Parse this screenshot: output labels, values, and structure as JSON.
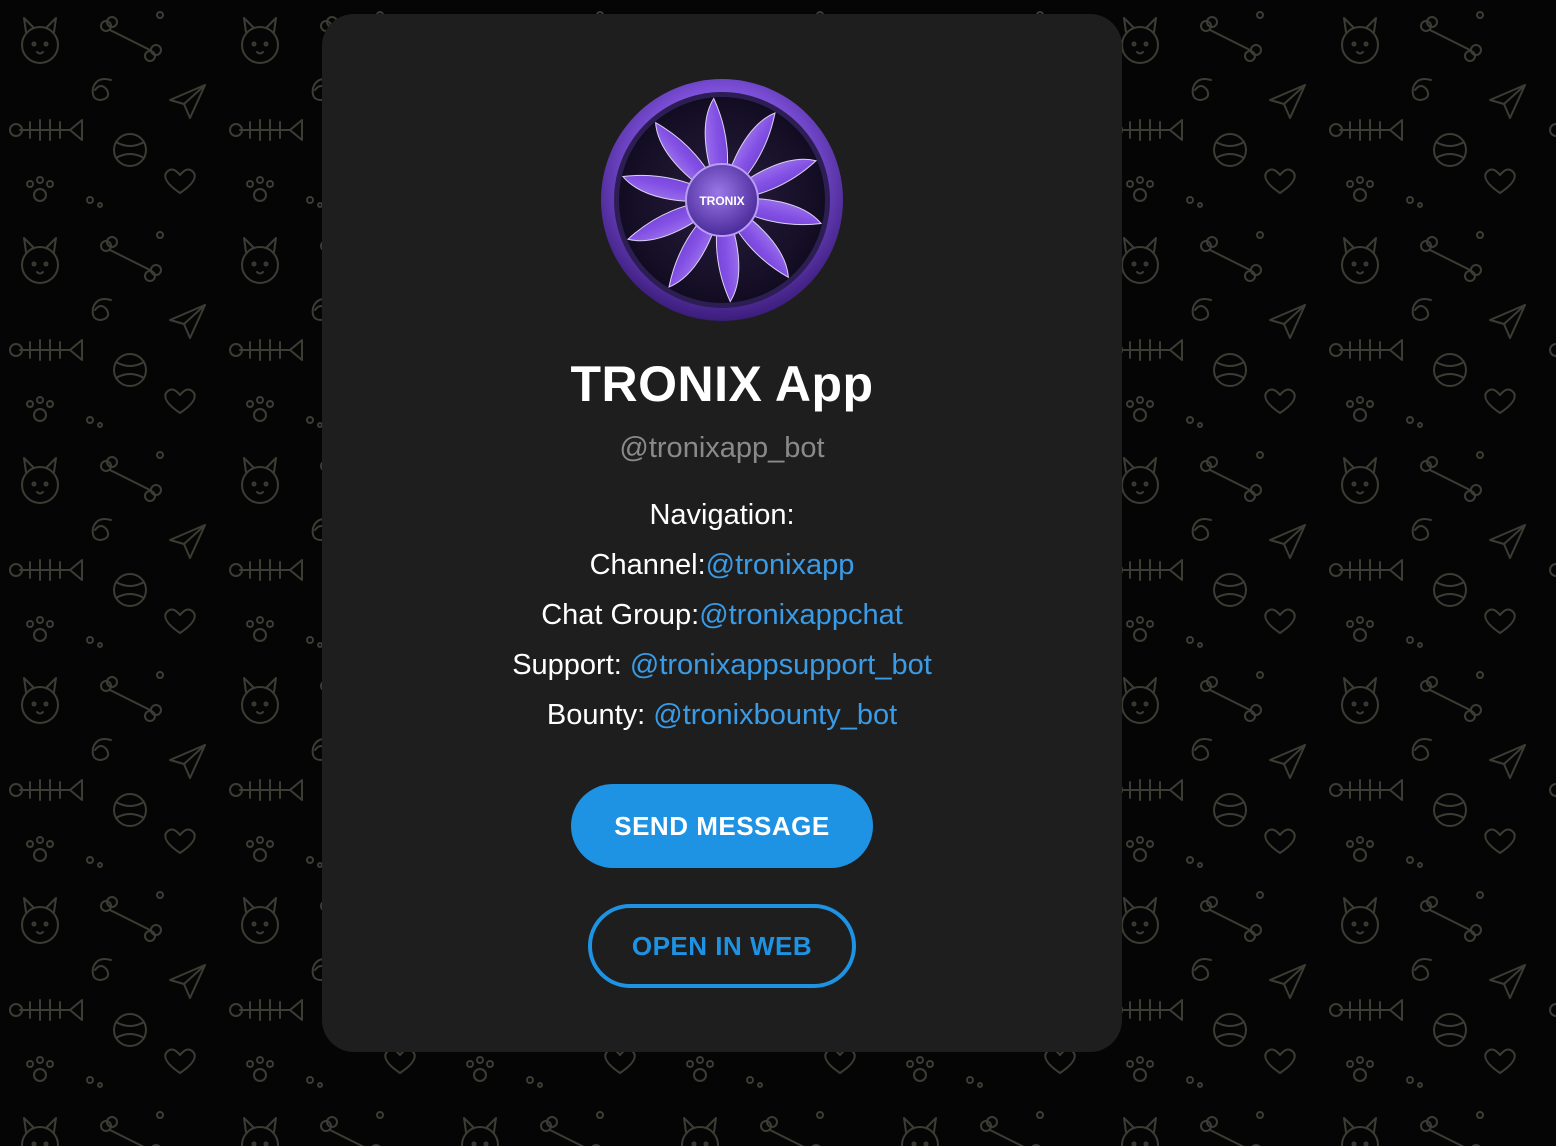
{
  "bot": {
    "name": "TRONIX App",
    "username": "@tronixapp_bot",
    "avatar_label": "TRONIX"
  },
  "description": {
    "heading": "Navigation:",
    "links": [
      {
        "label": "Channel:",
        "handle": "@tronixapp"
      },
      {
        "label": "Chat Group:",
        "handle": "@tronixappchat"
      },
      {
        "label": "Support: ",
        "handle": "@tronixappsupport_bot"
      },
      {
        "label": "Bounty: ",
        "handle": "@tronixbounty_bot"
      }
    ]
  },
  "buttons": {
    "send_message": "SEND MESSAGE",
    "open_in_web": "OPEN IN WEB"
  },
  "colors": {
    "accent": "#1e92e3",
    "link": "#3a9be6",
    "card": "#1e1e1e",
    "background": "#050505"
  },
  "icons": [
    "doodle-pattern-background",
    "tronix-fan-avatar"
  ]
}
